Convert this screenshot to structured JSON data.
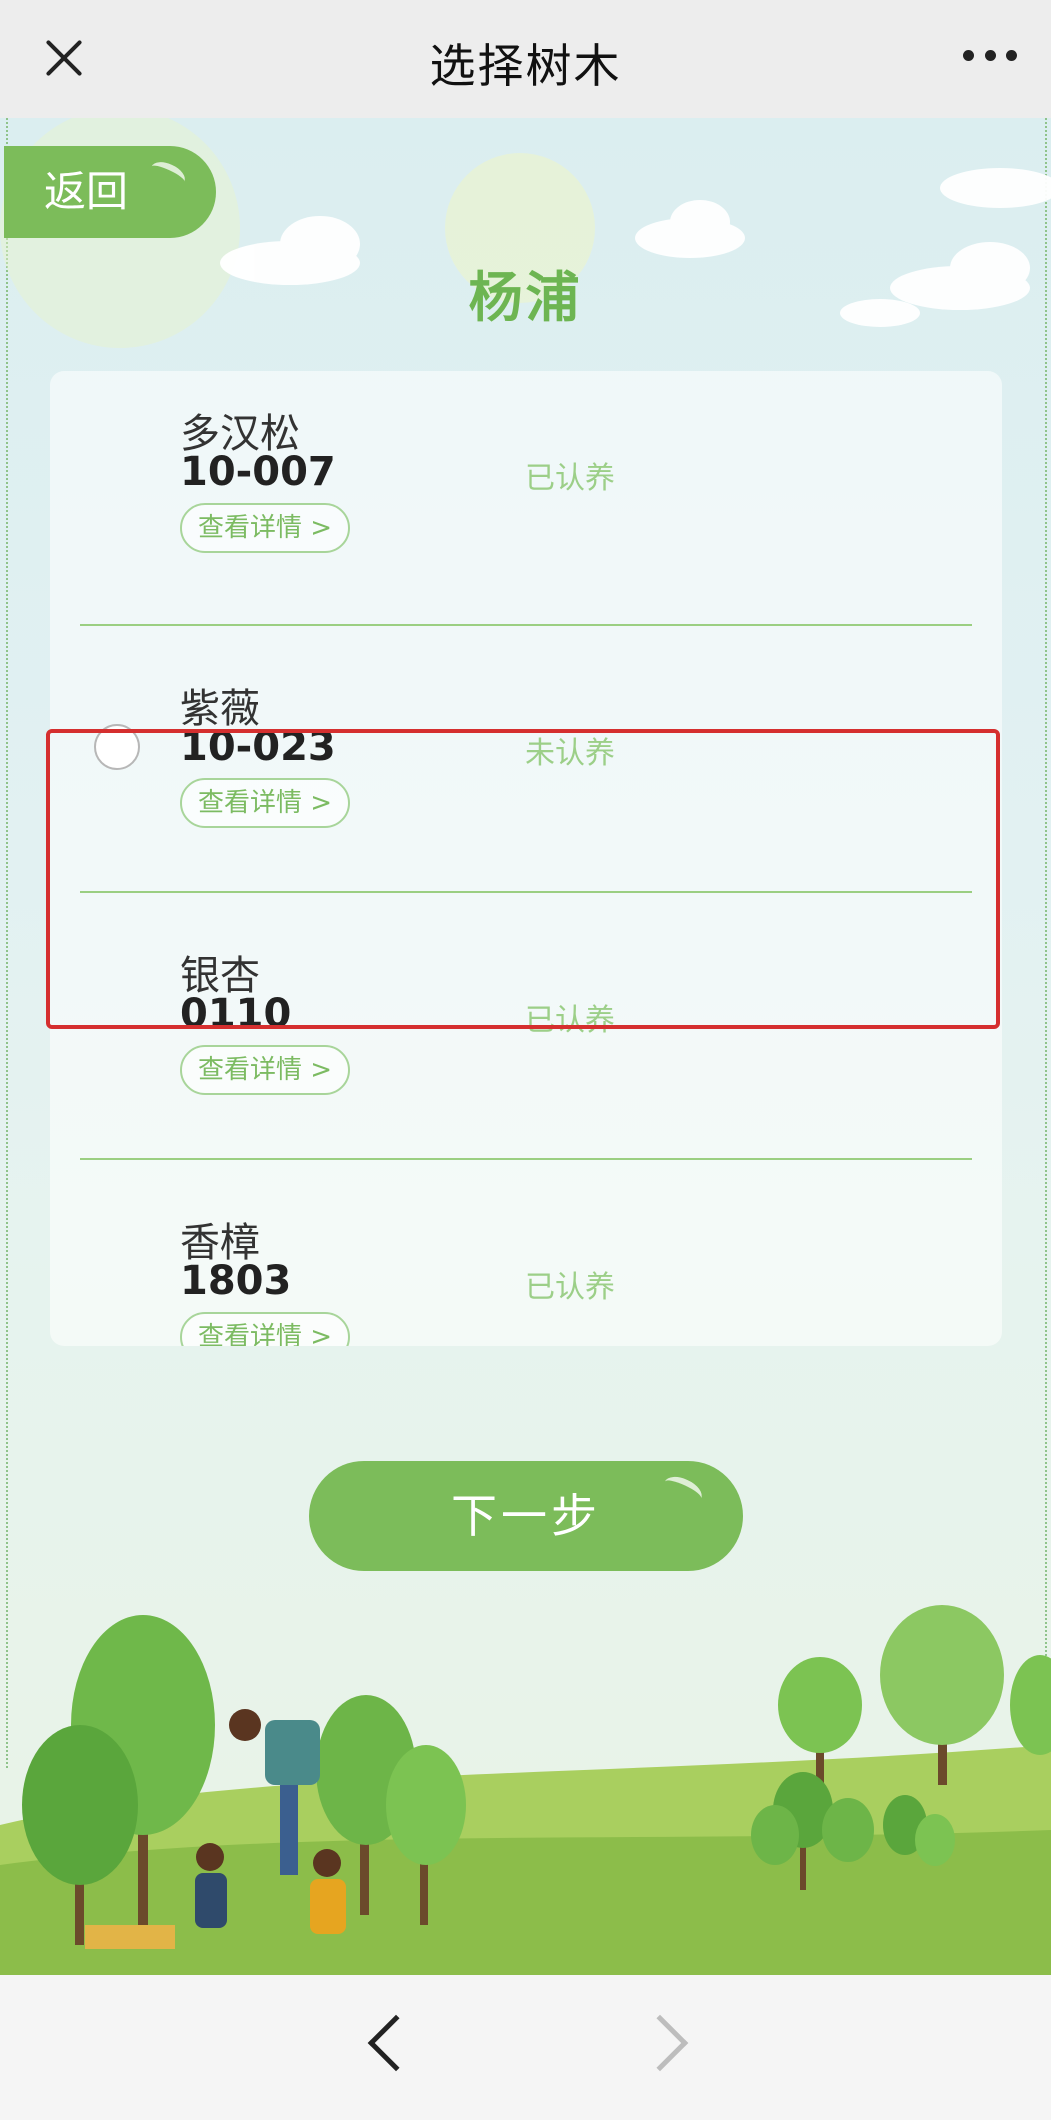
{
  "topbar": {
    "title": "选择树木"
  },
  "back_label": "返回",
  "district": "杨浦",
  "items": [
    {
      "name": "多汉松",
      "code": "10-007",
      "status": "已认养",
      "detail": "查看详情 >",
      "selectable": false
    },
    {
      "name": "紫薇",
      "code": "10-023",
      "status": "未认养",
      "detail": "查看详情 >",
      "selectable": true
    },
    {
      "name": "银杏",
      "code": "0110",
      "status": "已认养",
      "detail": "查看详情 >",
      "selectable": false
    },
    {
      "name": "香樟",
      "code": "1803",
      "status": "已认养",
      "detail": "查看详情 >",
      "selectable": false
    }
  ],
  "next_label": "下一步",
  "colors": {
    "accent": "#7cbc5a",
    "highlight": "#d52f2f"
  }
}
